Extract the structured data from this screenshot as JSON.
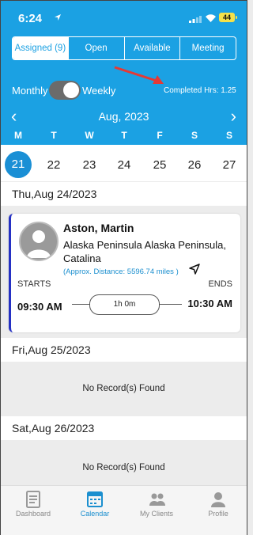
{
  "status_bar": {
    "time": "6:24",
    "battery": "44"
  },
  "tabs": [
    "Assigned (9)",
    "Open",
    "Available",
    "Meeting"
  ],
  "view_toggle": {
    "left_label": "Monthly",
    "right_label": "Weekly",
    "selected": "Weekly"
  },
  "completed_hours": "Completed Hrs:  1.25",
  "calendar": {
    "month_label": "Aug, 2023",
    "weekdays": [
      "M",
      "T",
      "W",
      "T",
      "F",
      "S",
      "S"
    ],
    "dates": [
      "21",
      "22",
      "23",
      "24",
      "25",
      "26",
      "27"
    ],
    "selected_date": "21"
  },
  "days": [
    {
      "heading": "Thu,Aug 24/2023"
    },
    {
      "heading": "Fri,Aug 25/2023",
      "empty_text": "No Record(s) Found"
    },
    {
      "heading": "Sat,Aug 26/2023",
      "empty_text": "No Record(s) Found"
    }
  ],
  "visit": {
    "client_name": "Aston, Martin",
    "address": "Alaska Peninsula Alaska Peninsula, Catalina",
    "distance": "(Approx. Distance: 5596.74 miles )",
    "starts_label": "STARTS",
    "ends_label": "ENDS",
    "start_time": "09:30 AM",
    "end_time": "10:30 AM",
    "duration": "1h 0m",
    "accent_color": "#2430c4"
  },
  "bottom_nav": [
    {
      "label": "Dashboard",
      "icon": "dashboard-icon"
    },
    {
      "label": "Calendar",
      "icon": "calendar-icon",
      "active": true
    },
    {
      "label": "My Clients",
      "icon": "clients-icon"
    },
    {
      "label": "Profile",
      "icon": "profile-icon"
    }
  ],
  "colors": {
    "header": "#1ba1e3",
    "selected_date": "#1a8fd5",
    "active_tab": "#1b8fcf"
  }
}
